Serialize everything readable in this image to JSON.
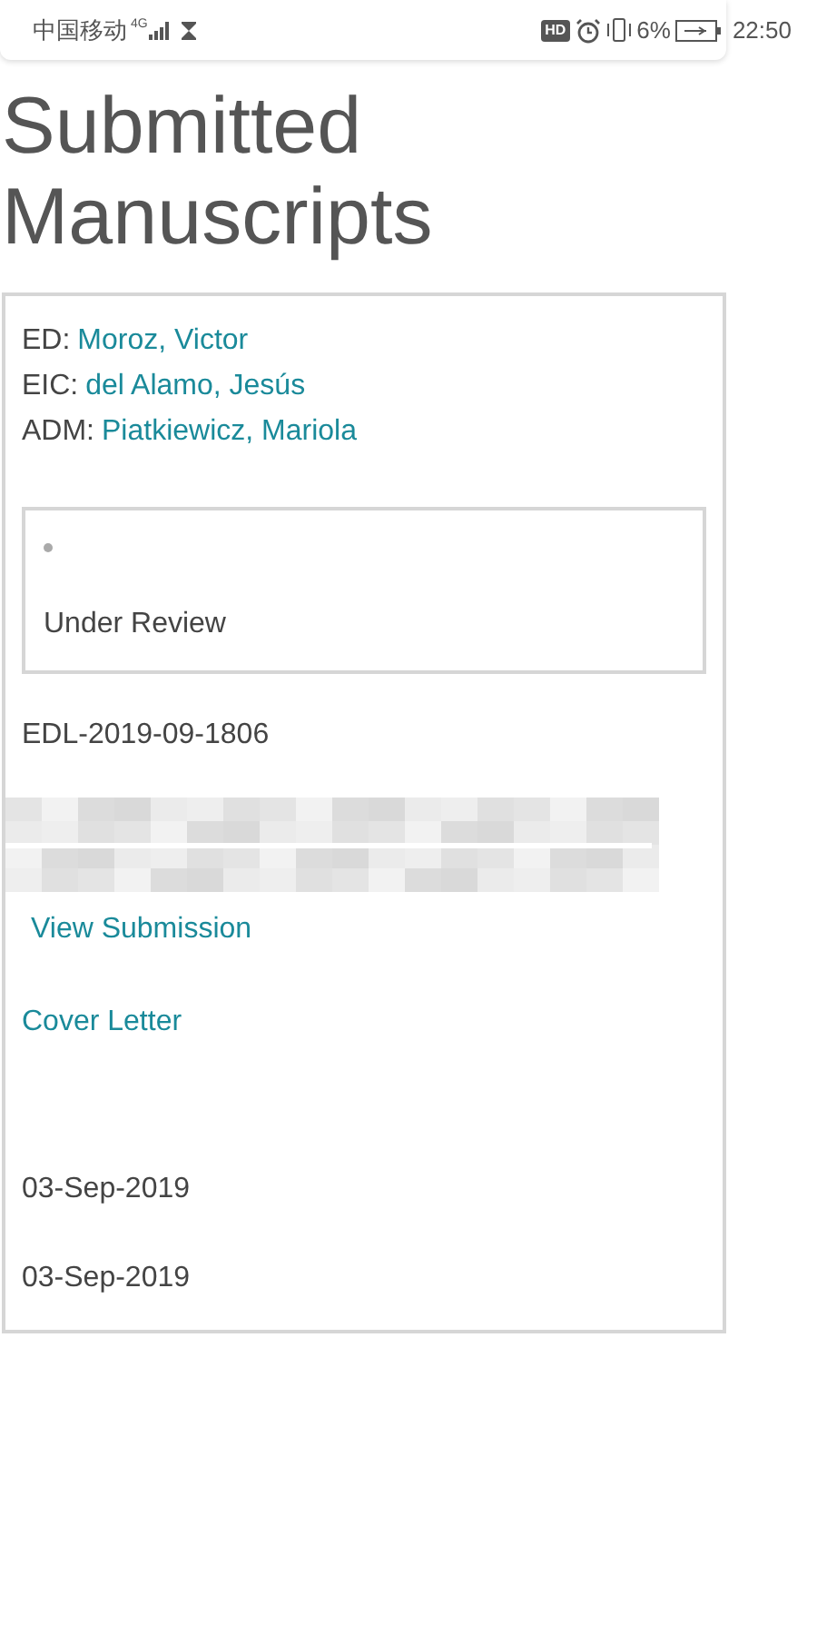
{
  "status_bar": {
    "carrier": "中国移动",
    "network": "4G",
    "hd": "HD",
    "battery": "6%",
    "time": "22:50"
  },
  "title": "Submitted Manuscripts",
  "manuscript": {
    "editors": [
      {
        "role": "ED:",
        "name": "Moroz, Victor"
      },
      {
        "role": "EIC:",
        "name": "del Alamo, Jesús"
      },
      {
        "role": "ADM:",
        "name": "Piatkiewicz, Mariola"
      }
    ],
    "status": "Under Review",
    "id": "EDL-2019-09-1806",
    "links": [
      "View Submission",
      "Cover Letter"
    ],
    "dates": [
      "03-Sep-2019",
      "03-Sep-2019"
    ]
  }
}
